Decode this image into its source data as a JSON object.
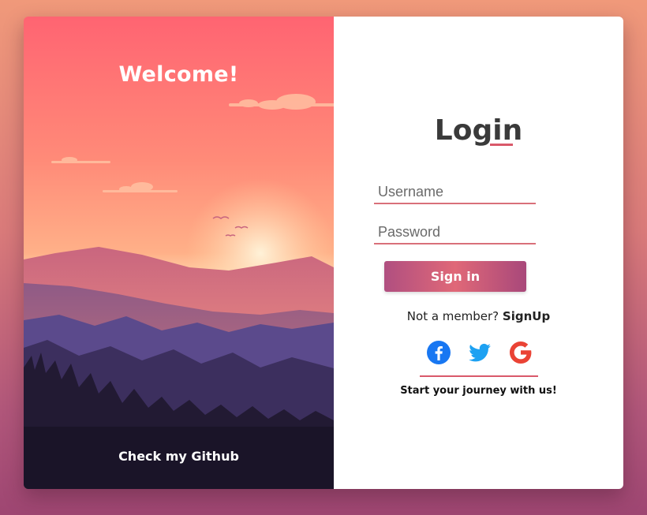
{
  "left_panel": {
    "welcome_text": "Welcome!",
    "github_link": "Check my Github"
  },
  "login": {
    "title": "Login",
    "username_placeholder": "Username",
    "username_value": "",
    "password_placeholder": "Password",
    "password_value": "",
    "signin_label": "Sign in",
    "not_member_text": "Not a member?",
    "signup_label": "SignUp",
    "socials": [
      "facebook-icon",
      "twitter-icon",
      "google-icon"
    ],
    "journey_text": "Start your journey with us!"
  },
  "colors": {
    "accent": "#d9596a",
    "facebook": "#1877f2",
    "twitter": "#1da1f2",
    "google": "#ea4335"
  }
}
